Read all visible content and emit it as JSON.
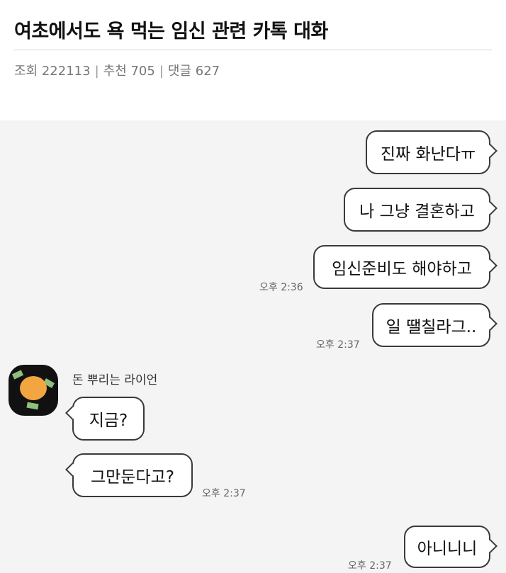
{
  "post": {
    "title": "여초에서도 욕 먹는 임신 관련 카톡 대화",
    "views_label": "조회 222113",
    "recommends_label": "추천 705",
    "comments_label": "댓글 627",
    "separator": "|"
  },
  "chat": {
    "sender_name": "돈 뿌리는 라이언",
    "messages": [
      {
        "text": "진짜 화난다ㅠ",
        "side": "mine"
      },
      {
        "text": "나 그냥 결혼하고",
        "side": "mine"
      },
      {
        "text": "임신준비도 해야하고",
        "side": "mine",
        "time": "오후 2:36"
      },
      {
        "text": "일 땔칠라그..",
        "side": "mine",
        "time": "오후 2:37"
      },
      {
        "text": "지금?",
        "side": "theirs"
      },
      {
        "text": "그만둔다고?",
        "side": "theirs",
        "time": "오후 2:37"
      },
      {
        "text": "아니니니",
        "side": "mine",
        "time": "오후 2:37"
      }
    ]
  },
  "colors": {
    "chat_background": "#f4f4f4",
    "bubble_border": "#3a3a3a",
    "avatar_color": "#f2a541"
  },
  "icons": {
    "avatar": "ryan-character-avatar"
  }
}
